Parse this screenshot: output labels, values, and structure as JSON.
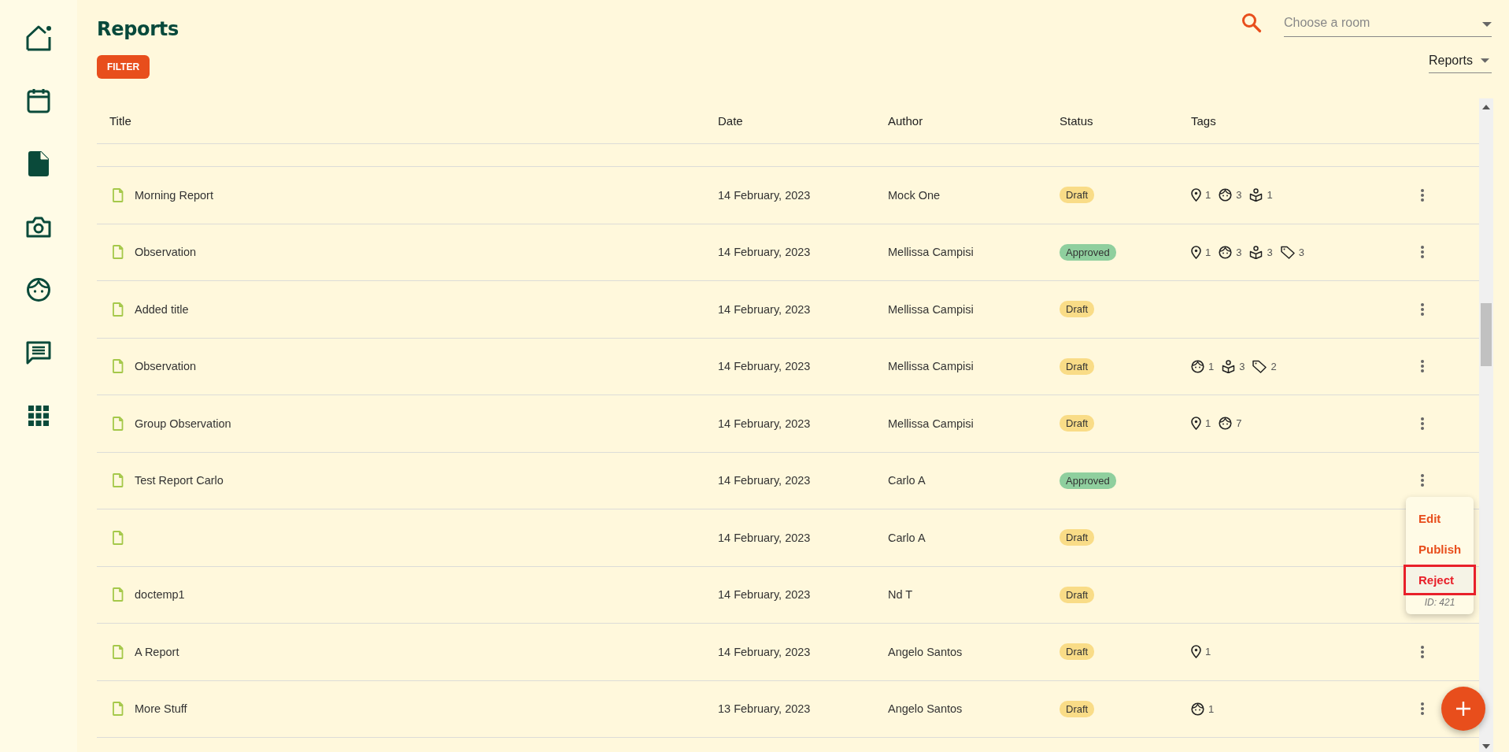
{
  "sidebar": {
    "items": [
      {
        "kind": "home",
        "selected": false
      },
      {
        "kind": "calendar",
        "selected": false
      },
      {
        "kind": "document",
        "selected": true
      },
      {
        "kind": "camera",
        "selected": false
      },
      {
        "kind": "child",
        "selected": false
      },
      {
        "kind": "chat",
        "selected": false
      },
      {
        "kind": "apps",
        "selected": false
      }
    ]
  },
  "header": {
    "title": "Reports",
    "room_select": {
      "placeholder": "Choose a room"
    },
    "filter_button": "FILTER",
    "view_select": {
      "value": "Reports"
    }
  },
  "table": {
    "columns": [
      "Title",
      "Date",
      "Author",
      "Status",
      "Tags"
    ],
    "rows": [
      {
        "title": "Morning Report",
        "date": "14 February, 2023",
        "author": "Mock One",
        "status": {
          "label": "Draft",
          "color": "#f9dc87"
        },
        "tags": [
          {
            "kind": "location",
            "count": "1"
          },
          {
            "kind": "child",
            "count": "3"
          },
          {
            "kind": "learning",
            "count": "1"
          }
        ]
      },
      {
        "title": "Observation",
        "date": "14 February, 2023",
        "author": "Mellissa Campisi",
        "status": {
          "label": "Approved",
          "color": "#8fcf9e"
        },
        "tags": [
          {
            "kind": "location",
            "count": "1"
          },
          {
            "kind": "child",
            "count": "3"
          },
          {
            "kind": "learning",
            "count": "3"
          },
          {
            "kind": "tag",
            "count": "3"
          }
        ]
      },
      {
        "title": "Added title",
        "date": "14 February, 2023",
        "author": "Mellissa Campisi",
        "status": {
          "label": "Draft",
          "color": "#f9dc87"
        },
        "tags": []
      },
      {
        "title": "Observation",
        "date": "14 February, 2023",
        "author": "Mellissa Campisi",
        "status": {
          "label": "Draft",
          "color": "#f9dc87"
        },
        "tags": [
          {
            "kind": "child",
            "count": "1"
          },
          {
            "kind": "learning",
            "count": "3"
          },
          {
            "kind": "tag",
            "count": "2"
          }
        ]
      },
      {
        "title": "Group Observation",
        "date": "14 February, 2023",
        "author": "Mellissa Campisi",
        "status": {
          "label": "Draft",
          "color": "#f9dc87"
        },
        "tags": [
          {
            "kind": "location",
            "count": "1"
          },
          {
            "kind": "child",
            "count": "7"
          }
        ]
      },
      {
        "title": "Test Report Carlo",
        "date": "14 February, 2023",
        "author": "Carlo A",
        "status": {
          "label": "Approved",
          "color": "#8fcf9e"
        },
        "tags": []
      },
      {
        "date": "14 February, 2023",
        "author": "Carlo A",
        "status": {
          "label": "Draft",
          "color": "#f9dc87"
        },
        "tags": [],
        "more_button_covered": true
      },
      {
        "title": "doctemp1",
        "date": "14 February, 2023",
        "author": "Nd T",
        "status": {
          "label": "Draft",
          "color": "#f9dc87"
        },
        "tags": [],
        "more_button_covered": true
      },
      {
        "title": "A Report",
        "date": "14 February, 2023",
        "author": "Angelo Santos",
        "status": {
          "label": "Draft",
          "color": "#f9dc87"
        },
        "tags": [
          {
            "kind": "location",
            "count": "1"
          }
        ]
      },
      {
        "title": "More Stuff",
        "date": "13 February, 2023",
        "author": "Angelo Santos",
        "status": {
          "label": "Draft",
          "color": "#f9dc87"
        },
        "tags": [
          {
            "kind": "child",
            "count": "1"
          }
        ]
      }
    ]
  },
  "row_menu": {
    "items": [
      {
        "label": "Edit",
        "selected": false
      },
      {
        "label": "Publish",
        "selected": false
      },
      {
        "label": "Reject",
        "selected": true
      }
    ],
    "id_text": "ID: 421"
  }
}
